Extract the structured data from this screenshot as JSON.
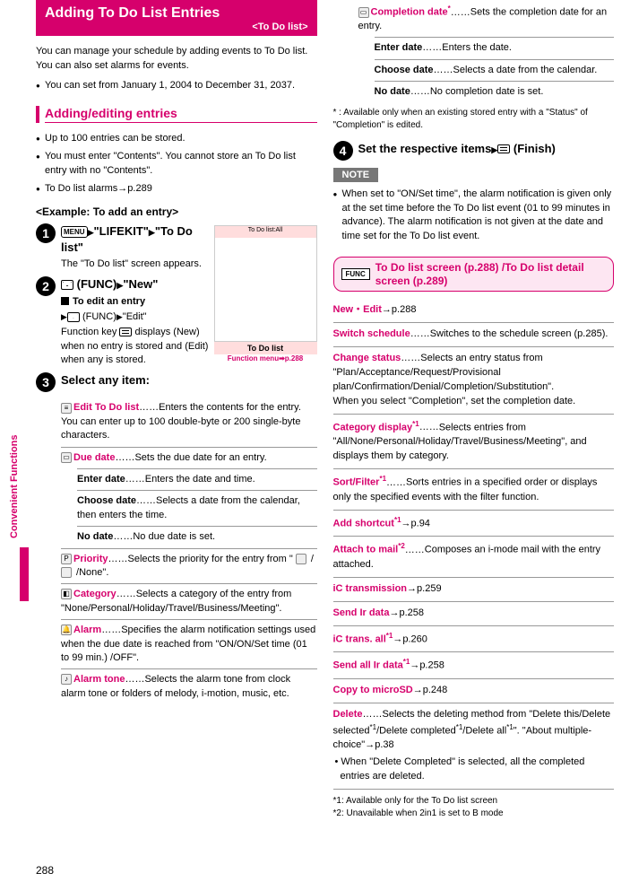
{
  "sideTab": "Convenient Functions",
  "pageNumber": "288",
  "col1": {
    "title": "Adding To Do List Entries",
    "subtitle": "<To Do list>",
    "intro": "You can manage your schedule by adding events to To Do list. You can also set alarms for events.",
    "bullet1": "You can set from January 1, 2004 to December 31, 2037.",
    "h2": "Adding/editing entries",
    "b1": "Up to 100 entries can be stored.",
    "b2": "You must enter \"Contents\". You cannot store an To Do list entry with no \"Contents\".",
    "b3": "To Do list alarms→p.289",
    "h3": "<Example: To add an entry>",
    "step1": {
      "menu": "MENU",
      "lifekit": "\"LIFEKIT\"",
      "todo": "\"To Do list\"",
      "body": "The \"To Do list\" screen appears."
    },
    "step2": {
      "func": "(FUNC)",
      "new": "\"New\"",
      "editT": "To edit an entry",
      "editFunc": "(FUNC)",
      "edit": "\"Edit\"",
      "body": "Function key ",
      "body2": " displays (New) when no entry is stored and (Edit) when any is stored."
    },
    "step3": "Select any item:",
    "screenshotTitle": "To Do list:All",
    "screenshotCap1": "To Do list",
    "screenshotCap2": "Function menu➡p.288",
    "items": {
      "editTodo": {
        "t": "Edit To Do list",
        "d": "Enters the contents for the entry. You can enter up to 100 double-byte or 200 single-byte characters."
      },
      "dueDate": {
        "t": "Due date",
        "d": "Sets the due date for an entry."
      },
      "enterDate": {
        "t": "Enter date",
        "d": "Enters the date and time."
      },
      "chooseDate": {
        "t": "Choose date",
        "d": "Selects a date from the calendar, then enters the time."
      },
      "noDate": {
        "t": "No date",
        "d": "No due date is set."
      },
      "priority": {
        "t": "Priority",
        "d": "Selects the priority for the entry from \" ",
        "d2": " / ",
        "d3": " /None\"."
      },
      "category": {
        "t": "Category",
        "d": "Selects a category of the entry from \"None/Personal/Holiday/Travel/Business/Meeting\"."
      },
      "alarm": {
        "t": "Alarm",
        "d": "Specifies the alarm notification settings used when the due date is reached from \"ON/ON/Set time (01 to 99 min.) /OFF\"."
      },
      "alarmTone": {
        "t": "Alarm tone",
        "d": "Selects the alarm tone from clock alarm tone or folders of melody, i-motion, music, etc."
      }
    }
  },
  "col2": {
    "completion": {
      "t": "Completion date",
      "star": "*",
      "d": "Sets the completion date for an entry."
    },
    "enterDate2": {
      "t": "Enter date",
      "d": "Enters the date."
    },
    "chooseDate2": {
      "t": "Choose date",
      "d": "Selects a date from the calendar."
    },
    "noDate2": {
      "t": "No date",
      "d": "No completion date is set."
    },
    "starNote": "* : Available only when an existing stored entry with a \"Status\" of \"Completion\" is edited.",
    "step4": {
      "t1": "Set the respective items",
      "t2": "(Finish)"
    },
    "noteLabel": "NOTE",
    "noteBody": "When set to \"ON/Set time\", the alarm notification is given only at the set time before the To Do list event (01 to 99 minutes in advance). The alarm notification is not given at the date and time set for the To Do list event.",
    "funcBtn": "FUNC",
    "funcTitle": "To Do list screen (p.288) /To Do list detail screen (p.289)",
    "fn": {
      "newEdit": {
        "t": "New・Edit",
        "ref": "→p.288"
      },
      "switch": {
        "t": "Switch schedule",
        "d": "Switches to the schedule screen (p.285)."
      },
      "change": {
        "t": "Change status",
        "d": "Selects an entry status from \"Plan/Acceptance/Request/Provisional plan/Confirmation/Denial/Completion/Substitution\".",
        "d2": "When you select \"Completion\", set the completion date."
      },
      "catDisp": {
        "t": "Category display",
        "s": "*1",
        "d": "Selects entries from \"All/None/Personal/Holiday/Travel/Business/Meeting\", and displays them by category."
      },
      "sort": {
        "t": "Sort/Filter",
        "s": "*1",
        "d": "Sorts entries in a specified order or displays only the specified events with the filter function."
      },
      "shortcut": {
        "t": "Add shortcut",
        "s": "*1",
        "ref": "→p.94"
      },
      "attach": {
        "t": "Attach to mail",
        "s": "*2",
        "d": "Composes an i-mode mail with the entry attached."
      },
      "icTrans": {
        "t": "iC transmission",
        "ref": "→p.259"
      },
      "sendIr": {
        "t": "Send Ir data",
        "ref": "→p.258"
      },
      "icAll": {
        "t": "iC trans. all",
        "s": "*1",
        "ref": "→p.260"
      },
      "sendIrAll": {
        "t": "Send all Ir data",
        "s": "*1",
        "ref": "→p.258"
      },
      "copySd": {
        "t": "Copy to microSD",
        "ref": "→p.248"
      },
      "delete": {
        "t": "Delete",
        "d": "Selects the deleting method from \"Delete this/Delete selected",
        "s1": "*1",
        "d2": "/Delete completed",
        "s2": "*1",
        "d3": "/Delete all",
        "s3": "*1",
        "d4": "\". \"About multiple-choice\"→p.38",
        "sub": "When \"Delete Completed\" is selected, all the completed entries are deleted."
      }
    },
    "foot1": "*1: Available only for the To Do list screen",
    "foot2": "*2: Unavailable when 2in1 is set to B mode"
  }
}
